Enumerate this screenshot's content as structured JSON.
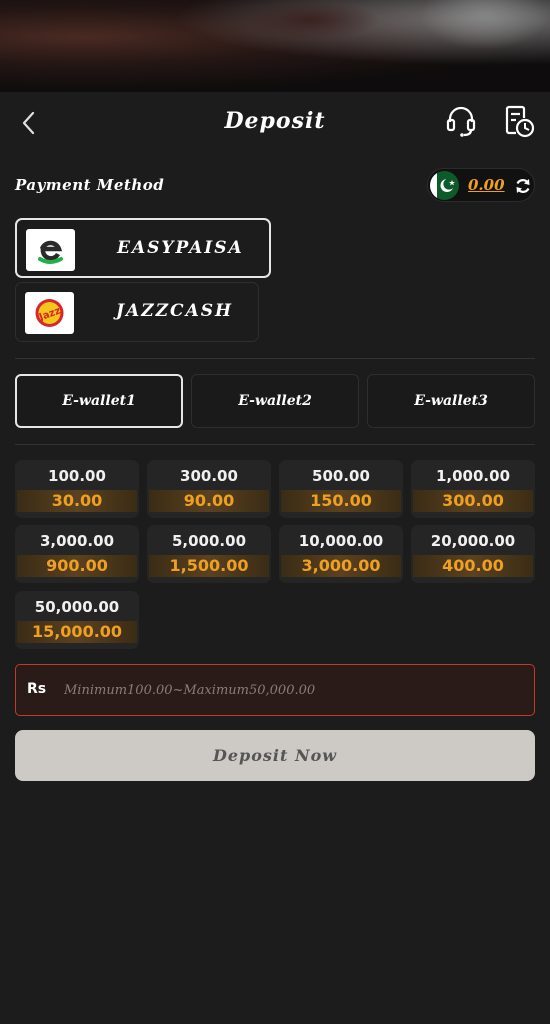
{
  "header": {
    "title": "Deposit",
    "back_icon": "chevron-left-icon",
    "support_icon": "headset-icon",
    "history_icon": "clock-document-icon"
  },
  "payment": {
    "label": "Payment Method",
    "balance": "0.00",
    "currency_flag": "pakistan-flag",
    "methods": [
      {
        "name": "EASYPAISA",
        "selected": true
      },
      {
        "name": "JAZZCASH",
        "selected": false
      }
    ]
  },
  "wallets": [
    {
      "label": "E-wallet1",
      "selected": true
    },
    {
      "label": "E-wallet2",
      "selected": false
    },
    {
      "label": "E-wallet3",
      "selected": false
    }
  ],
  "amounts": [
    {
      "amount": "100.00",
      "bonus": "30.00"
    },
    {
      "amount": "300.00",
      "bonus": "90.00"
    },
    {
      "amount": "500.00",
      "bonus": "150.00"
    },
    {
      "amount": "1,000.00",
      "bonus": "300.00"
    },
    {
      "amount": "3,000.00",
      "bonus": "900.00"
    },
    {
      "amount": "5,000.00",
      "bonus": "1,500.00"
    },
    {
      "amount": "10,000.00",
      "bonus": "3,000.00"
    },
    {
      "amount": "20,000.00",
      "bonus": "400.00"
    },
    {
      "amount": "50,000.00",
      "bonus": "15,000.00"
    }
  ],
  "input": {
    "currency": "Rs",
    "placeholder": "Minimum100.00~Maximum50,000.00",
    "value": ""
  },
  "submit": {
    "label": "Deposit Now"
  },
  "colors": {
    "accent": "#f0a020",
    "background": "#1c1c1c",
    "input_border": "#c23a2a"
  }
}
